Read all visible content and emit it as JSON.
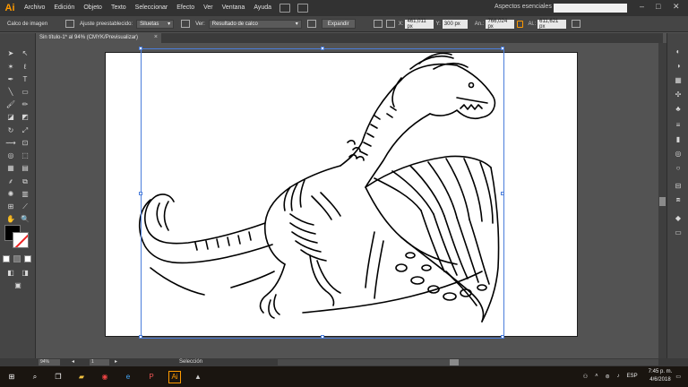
{
  "app": {
    "logo": "Ai"
  },
  "menu": [
    "Archivo",
    "Edición",
    "Objeto",
    "Texto",
    "Seleccionar",
    "Efecto",
    "Ver",
    "Ventana",
    "Ayuda"
  ],
  "workspace": "Aspectos esenciales",
  "control": {
    "panel_label": "Calco de imagen",
    "preset_label": "Ajuste preestablecido:",
    "preset_value": "Siluetas",
    "view_label": "Ver:",
    "view_value": "Resultado de calco",
    "expand_button": "Expandir",
    "x_label": "X:",
    "x_value": "461,011 px",
    "y_label": "Y:",
    "y_value": "300 px",
    "w_label": "An.:",
    "w_value": "766,024 px",
    "h_label": "Al.:",
    "h_value": "611,621 px"
  },
  "document": {
    "tab_title": "Sin título-1* al 94% (CMYK/Previsualizar)",
    "close": "×"
  },
  "status": {
    "zoom": "94%",
    "page": "1",
    "tool": "Selección"
  },
  "taskbar": {
    "time": "7:45 p. m.",
    "date": "4/6/2018",
    "lang": "ESP"
  },
  "icons": [
    "selection-icon",
    "direct-selection-icon",
    "magic-wand-icon",
    "lasso-icon",
    "pen-icon",
    "type-icon",
    "line-icon",
    "rectangle-icon",
    "paintbrush-icon",
    "pencil-icon",
    "rotate-icon",
    "scale-icon",
    "eyedropper-icon",
    "hand-icon",
    "zoom-icon"
  ],
  "colors": {
    "accent": "#ff9a00",
    "selection": "#4a7ddb"
  }
}
